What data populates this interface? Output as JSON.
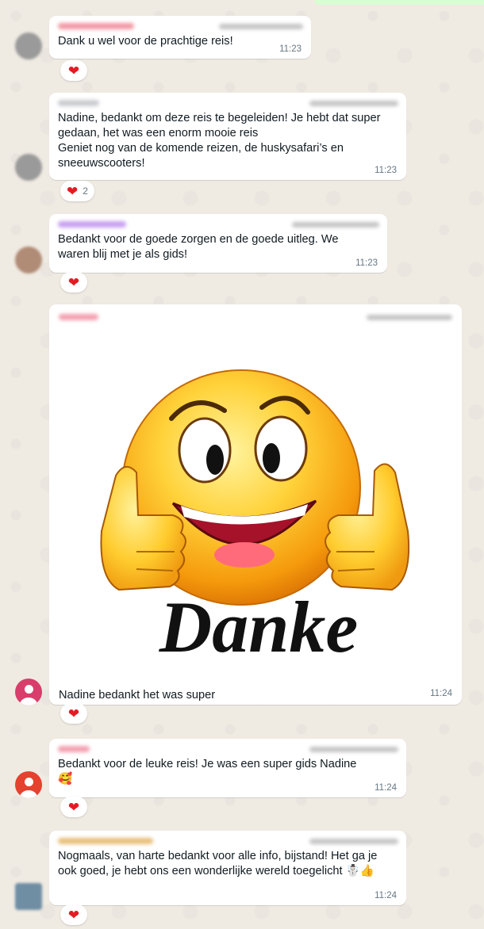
{
  "messages": [
    {
      "text": "Dank u wel voor de prachtige reis!",
      "time": "11:23",
      "reaction": {
        "emoji": "heart",
        "count": ""
      }
    },
    {
      "text": "Nadine, bedankt om deze reis te begeleiden! Je hebt dat super gedaan, het was een enorm mooie reis\nGeniet nog van de komende reizen, de huskysafari’s en sneeuwscooters!",
      "time": "11:23",
      "reaction": {
        "emoji": "heart",
        "count": "2"
      }
    },
    {
      "text": "Bedankt voor de goede zorgen en de goede uitleg. We waren blij met je als gids!",
      "time": "11:23",
      "reaction": {
        "emoji": "heart",
        "count": ""
      }
    },
    {
      "image_text": "Danke",
      "caption": "Nadine bedankt het was super",
      "time": "11:24",
      "reaction": {
        "emoji": "heart",
        "count": ""
      }
    },
    {
      "text": "Bedankt voor de leuke reis! Je was een super gids Nadine\n🥰",
      "time": "11:24",
      "reaction": {
        "emoji": "heart",
        "count": ""
      }
    },
    {
      "text": "Nogmaals,  van harte bedankt voor alle info, bijstand! Het ga je ook goed, je hebt ons een wonderlijke wereld toegelicht ☃️👍",
      "time": "11:24",
      "reaction": {
        "emoji": "heart",
        "count": ""
      }
    }
  ],
  "colors": {
    "chat_bg": "#efeae2",
    "bubble": "#ffffff",
    "outgoing": "#d9fdd3",
    "heart": "#e31b23"
  }
}
